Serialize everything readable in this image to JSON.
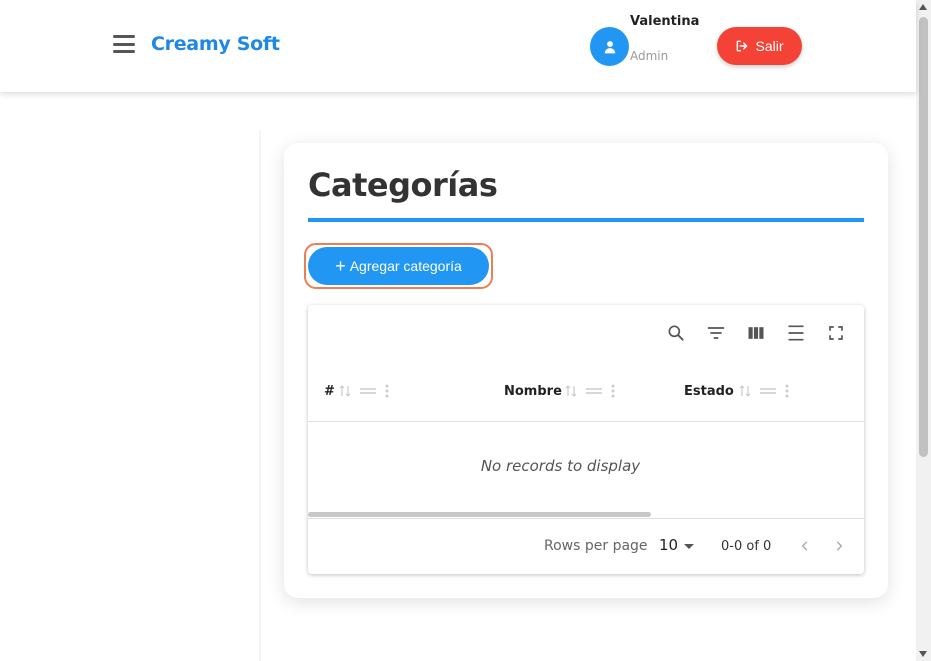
{
  "header": {
    "brand": "Creamy Soft",
    "user": {
      "name": "Valentina",
      "role": "Admin"
    },
    "logout_label": "Salir"
  },
  "page": {
    "title": "Categorías",
    "add_button_label": "Agregar categoría"
  },
  "table": {
    "toolbar_icons": [
      "search-icon",
      "filter-icon",
      "columns-icon",
      "density-icon",
      "fullscreen-icon"
    ],
    "columns": [
      "#",
      "Nombre",
      "Estado"
    ],
    "empty_message": "No records to display",
    "footer": {
      "rows_per_page_label": "Rows per page",
      "rows_per_page_value": "10",
      "range_text": "0-0 of 0"
    }
  },
  "colors": {
    "accent": "#2196f3",
    "brand": "#1e88e5",
    "danger": "#f44336",
    "focus_ring": "#ef7d54"
  }
}
